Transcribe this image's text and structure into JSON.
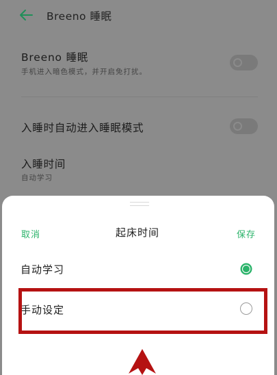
{
  "header": {
    "title": "Breeno 睡眠"
  },
  "settings": {
    "sleep": {
      "title": "Breeno 睡眠",
      "subtitle": "手机进入暗色模式，并开启免打扰。"
    },
    "auto_mode": {
      "title": "入睡时自动进入睡眠模式"
    },
    "sleep_time": {
      "title": "入睡时间",
      "subtitle": "自动学习"
    }
  },
  "sheet": {
    "cancel_label": "取消",
    "title": "起床时间",
    "save_label": "保存",
    "options": [
      {
        "label": "自动学习",
        "selected": true
      },
      {
        "label": "手动设定",
        "selected": false
      }
    ]
  },
  "colors": {
    "accent": "#2bb36a",
    "highlight": "#b51212",
    "scrim": "#8b8b8b"
  }
}
